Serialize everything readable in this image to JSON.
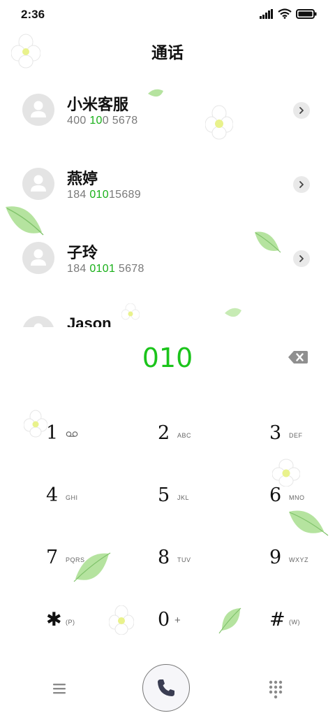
{
  "status": {
    "time": "2:36"
  },
  "header": {
    "title": "通话"
  },
  "contacts": [
    {
      "name": "小米客服",
      "number_parts": [
        {
          "t": "400",
          "h": false
        },
        {
          "t": " ",
          "h": false
        },
        {
          "t": "10",
          "h": true
        },
        {
          "t": "0 5678",
          "h": false
        }
      ]
    },
    {
      "name": "燕婷",
      "number_parts": [
        {
          "t": "184 ",
          "h": false
        },
        {
          "t": "010",
          "h": true
        },
        {
          "t": "15689",
          "h": false
        }
      ]
    },
    {
      "name": "子玲",
      "number_parts": [
        {
          "t": "184 ",
          "h": false
        },
        {
          "t": "0101",
          "h": true
        },
        {
          "t": " 5678",
          "h": false
        }
      ]
    },
    {
      "name": "Jason",
      "number_parts": []
    }
  ],
  "dialer": {
    "number": "010"
  },
  "keypad": [
    {
      "digit": "1",
      "letters": ""
    },
    {
      "digit": "2",
      "letters": "ABC"
    },
    {
      "digit": "3",
      "letters": "DEF"
    },
    {
      "digit": "4",
      "letters": "GHI"
    },
    {
      "digit": "5",
      "letters": "JKL"
    },
    {
      "digit": "6",
      "letters": "MNO"
    },
    {
      "digit": "7",
      "letters": "PQRS"
    },
    {
      "digit": "8",
      "letters": "TUV"
    },
    {
      "digit": "9",
      "letters": "WXYZ"
    },
    {
      "digit": "✱",
      "letters": "(P)"
    },
    {
      "digit": "0",
      "letters": "+"
    },
    {
      "digit": "#",
      "letters": "(W)"
    }
  ],
  "colors": {
    "accent": "#1bc41b",
    "match_highlight": "#19b019"
  },
  "icons": {
    "key1_extra": "voicemail-icon",
    "call": "phone-icon",
    "menu": "menu-icon",
    "dialpad": "dialpad-icon"
  }
}
